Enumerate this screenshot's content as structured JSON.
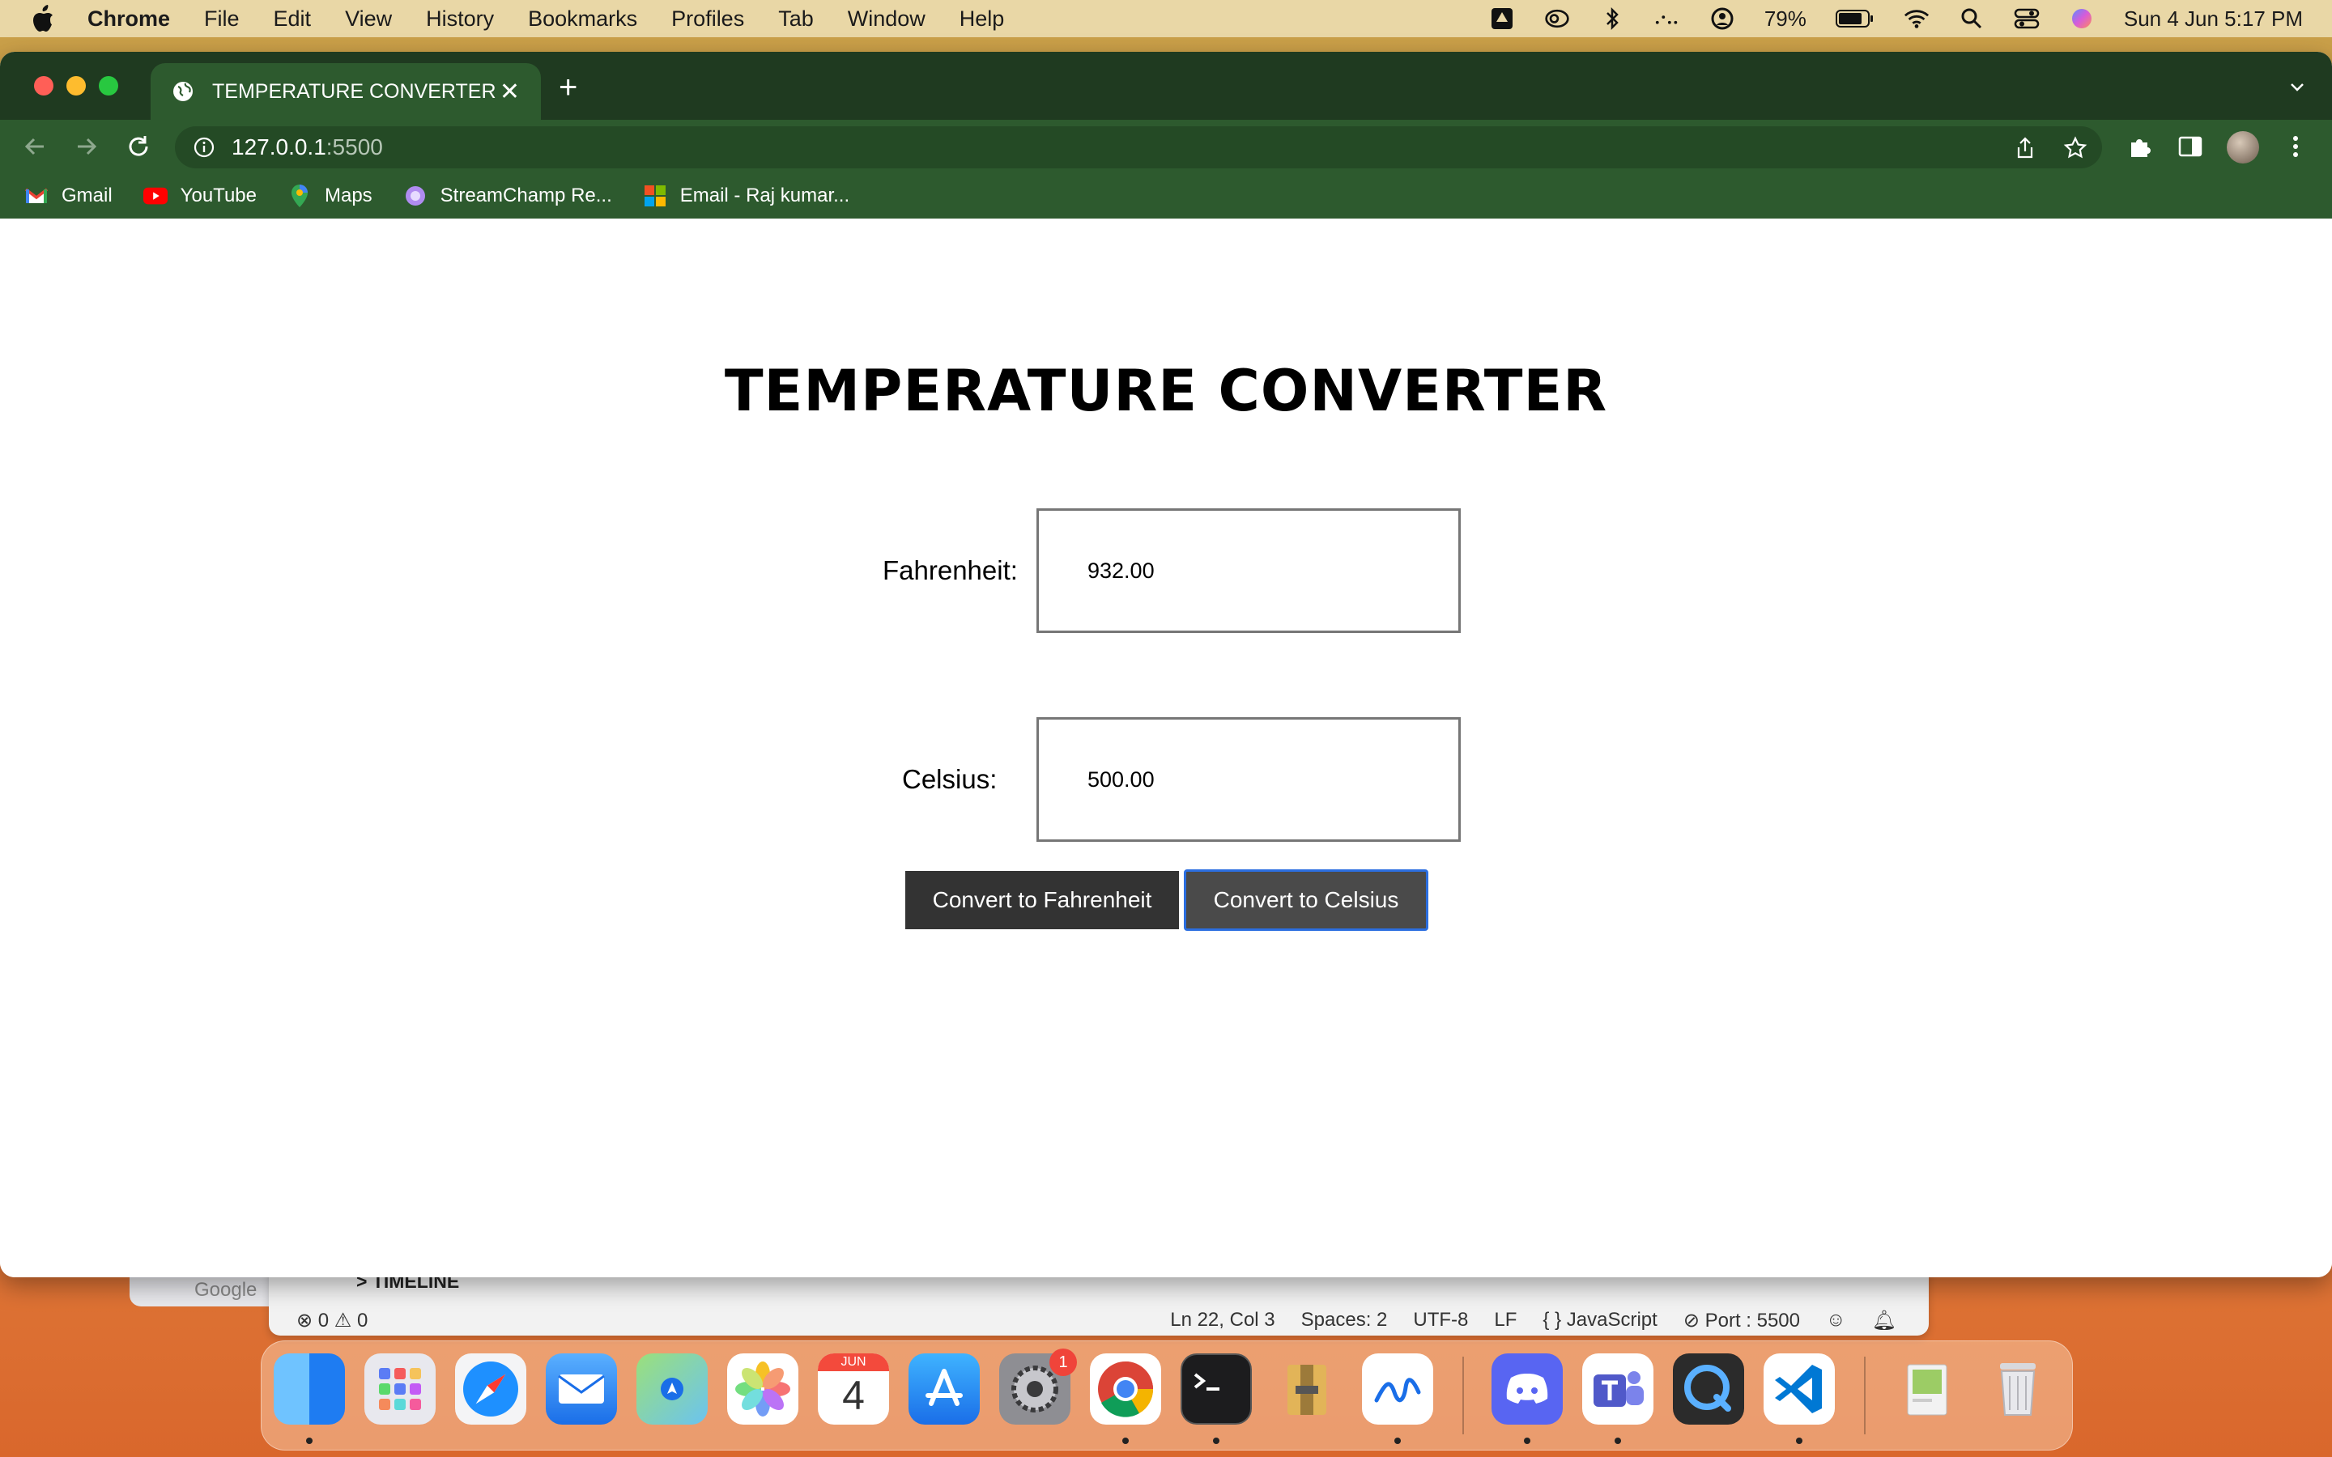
{
  "menubar": {
    "app": "Chrome",
    "items": [
      "File",
      "Edit",
      "View",
      "History",
      "Bookmarks",
      "Profiles",
      "Tab",
      "Window",
      "Help"
    ],
    "battery": "79%",
    "datetime": "Sun 4 Jun  5:17 PM"
  },
  "browser": {
    "tab_title": "TEMPERATURE CONVERTER",
    "url_host": "127.0.0.1",
    "url_port": ":5500",
    "bookmarks": [
      "Gmail",
      "YouTube",
      "Maps",
      "StreamChamp Re...",
      "Email - Raj kumar..."
    ],
    "theme_color": "#2d5a2e"
  },
  "page": {
    "title": "TEMPERATURE CONVERTER",
    "fahrenheit_label": "Fahrenheit:",
    "fahrenheit_value": "932.00",
    "celsius_label": "Celsius:",
    "celsius_value": "500.00",
    "to_f_button": "Convert to Fahrenheit",
    "to_c_button": "Convert to Celsius"
  },
  "vscode": {
    "timeline": "TIMELINE",
    "google": "Google",
    "errors": "0",
    "warnings": "0",
    "position": "Ln 22, Col 3",
    "spaces": "Spaces: 2",
    "encoding": "UTF-8",
    "eol": "LF",
    "language": "JavaScript",
    "port": "Port : 5500"
  },
  "dock": {
    "calendar_month": "JUN",
    "calendar_day": "4",
    "settings_badge": "1"
  }
}
